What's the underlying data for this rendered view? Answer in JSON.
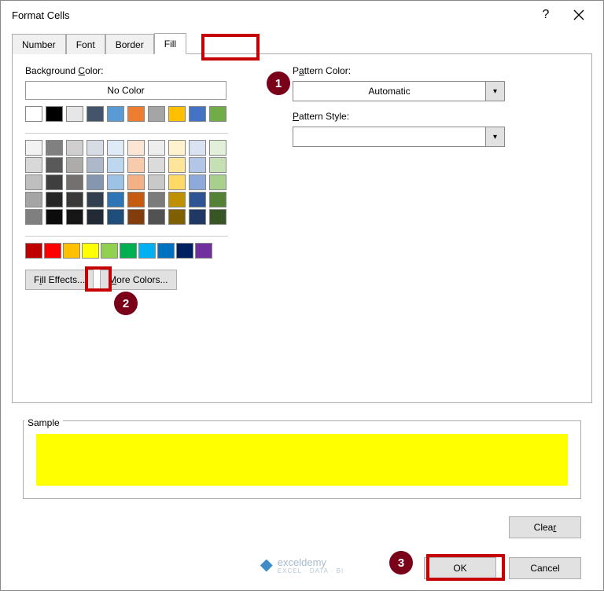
{
  "title": "Format Cells",
  "tabs": [
    "Number",
    "Font",
    "Border",
    "Fill"
  ],
  "active_tab": "Fill",
  "labels": {
    "bg_color": "Background Color:",
    "no_color": "No Color",
    "pattern_color": "Pattern Color:",
    "pattern_style": "Pattern Style:",
    "fill_effects": "Fill Effects...",
    "more_colors": "More Colors...",
    "sample": "Sample",
    "clear": "Clear",
    "ok": "OK",
    "cancel": "Cancel",
    "pattern_color_value": "Automatic"
  },
  "callouts": {
    "c1": "1",
    "c2": "2",
    "c3": "3"
  },
  "palette_row1": [
    "#FFFFFF",
    "#000000",
    "#E7E6E6",
    "#44546A",
    "#5B9BD5",
    "#ED7D31",
    "#A5A5A5",
    "#FFC000",
    "#4472C4",
    "#70AD47"
  ],
  "palette_grid": [
    [
      "#F2F2F2",
      "#808080",
      "#D0CECE",
      "#D6DCE4",
      "#DEEBF6",
      "#FBE5D5",
      "#EDEDED",
      "#FFF2CC",
      "#D9E2F3",
      "#E2EFD9"
    ],
    [
      "#D8D8D8",
      "#595959",
      "#AEABAB",
      "#ADB9CA",
      "#BDD7EE",
      "#F7CBAC",
      "#DBDBDB",
      "#FEE599",
      "#B4C6E7",
      "#C5E0B3"
    ],
    [
      "#BFBFBF",
      "#3F3F3F",
      "#757070",
      "#8496B0",
      "#9CC3E5",
      "#F4B183",
      "#C9C9C9",
      "#FFD965",
      "#8EAADB",
      "#A8D08D"
    ],
    [
      "#A5A5A5",
      "#262626",
      "#3A3838",
      "#323F4F",
      "#2E75B5",
      "#C55A11",
      "#7B7B7B",
      "#BF9000",
      "#2F5496",
      "#538135"
    ],
    [
      "#7F7F7F",
      "#0C0C0C",
      "#171616",
      "#222A35",
      "#1E4E79",
      "#833C0B",
      "#525252",
      "#7F6000",
      "#1F3864",
      "#375623"
    ]
  ],
  "standard_colors": [
    "#C00000",
    "#FF0000",
    "#FFC000",
    "#FFFF00",
    "#92D050",
    "#00B050",
    "#00B0F0",
    "#0070C0",
    "#002060",
    "#7030A0"
  ],
  "selected_color": "#FFFF00",
  "watermark": {
    "brand": "exceldemy",
    "tag": "EXCEL · DATA · BI"
  }
}
